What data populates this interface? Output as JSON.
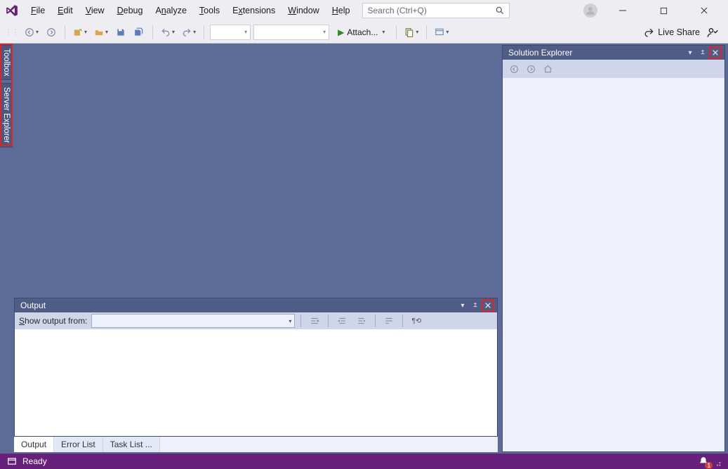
{
  "menu": {
    "items": [
      "File",
      "Edit",
      "View",
      "Debug",
      "Analyze",
      "Tools",
      "Extensions",
      "Window",
      "Help"
    ]
  },
  "search": {
    "placeholder": "Search (Ctrl+Q)"
  },
  "toolbar": {
    "attach_label": "Attach...",
    "live_share": "Live Share"
  },
  "left_tabs": {
    "toolbox": "Toolbox",
    "server_explorer": "Server Explorer"
  },
  "solution_explorer": {
    "title": "Solution Explorer"
  },
  "output": {
    "title": "Output",
    "show_label": "Show output from:"
  },
  "bottom_tabs": {
    "output": "Output",
    "error_list": "Error List",
    "task_list": "Task List ..."
  },
  "statusbar": {
    "status": "Ready",
    "notification_count": "1"
  }
}
